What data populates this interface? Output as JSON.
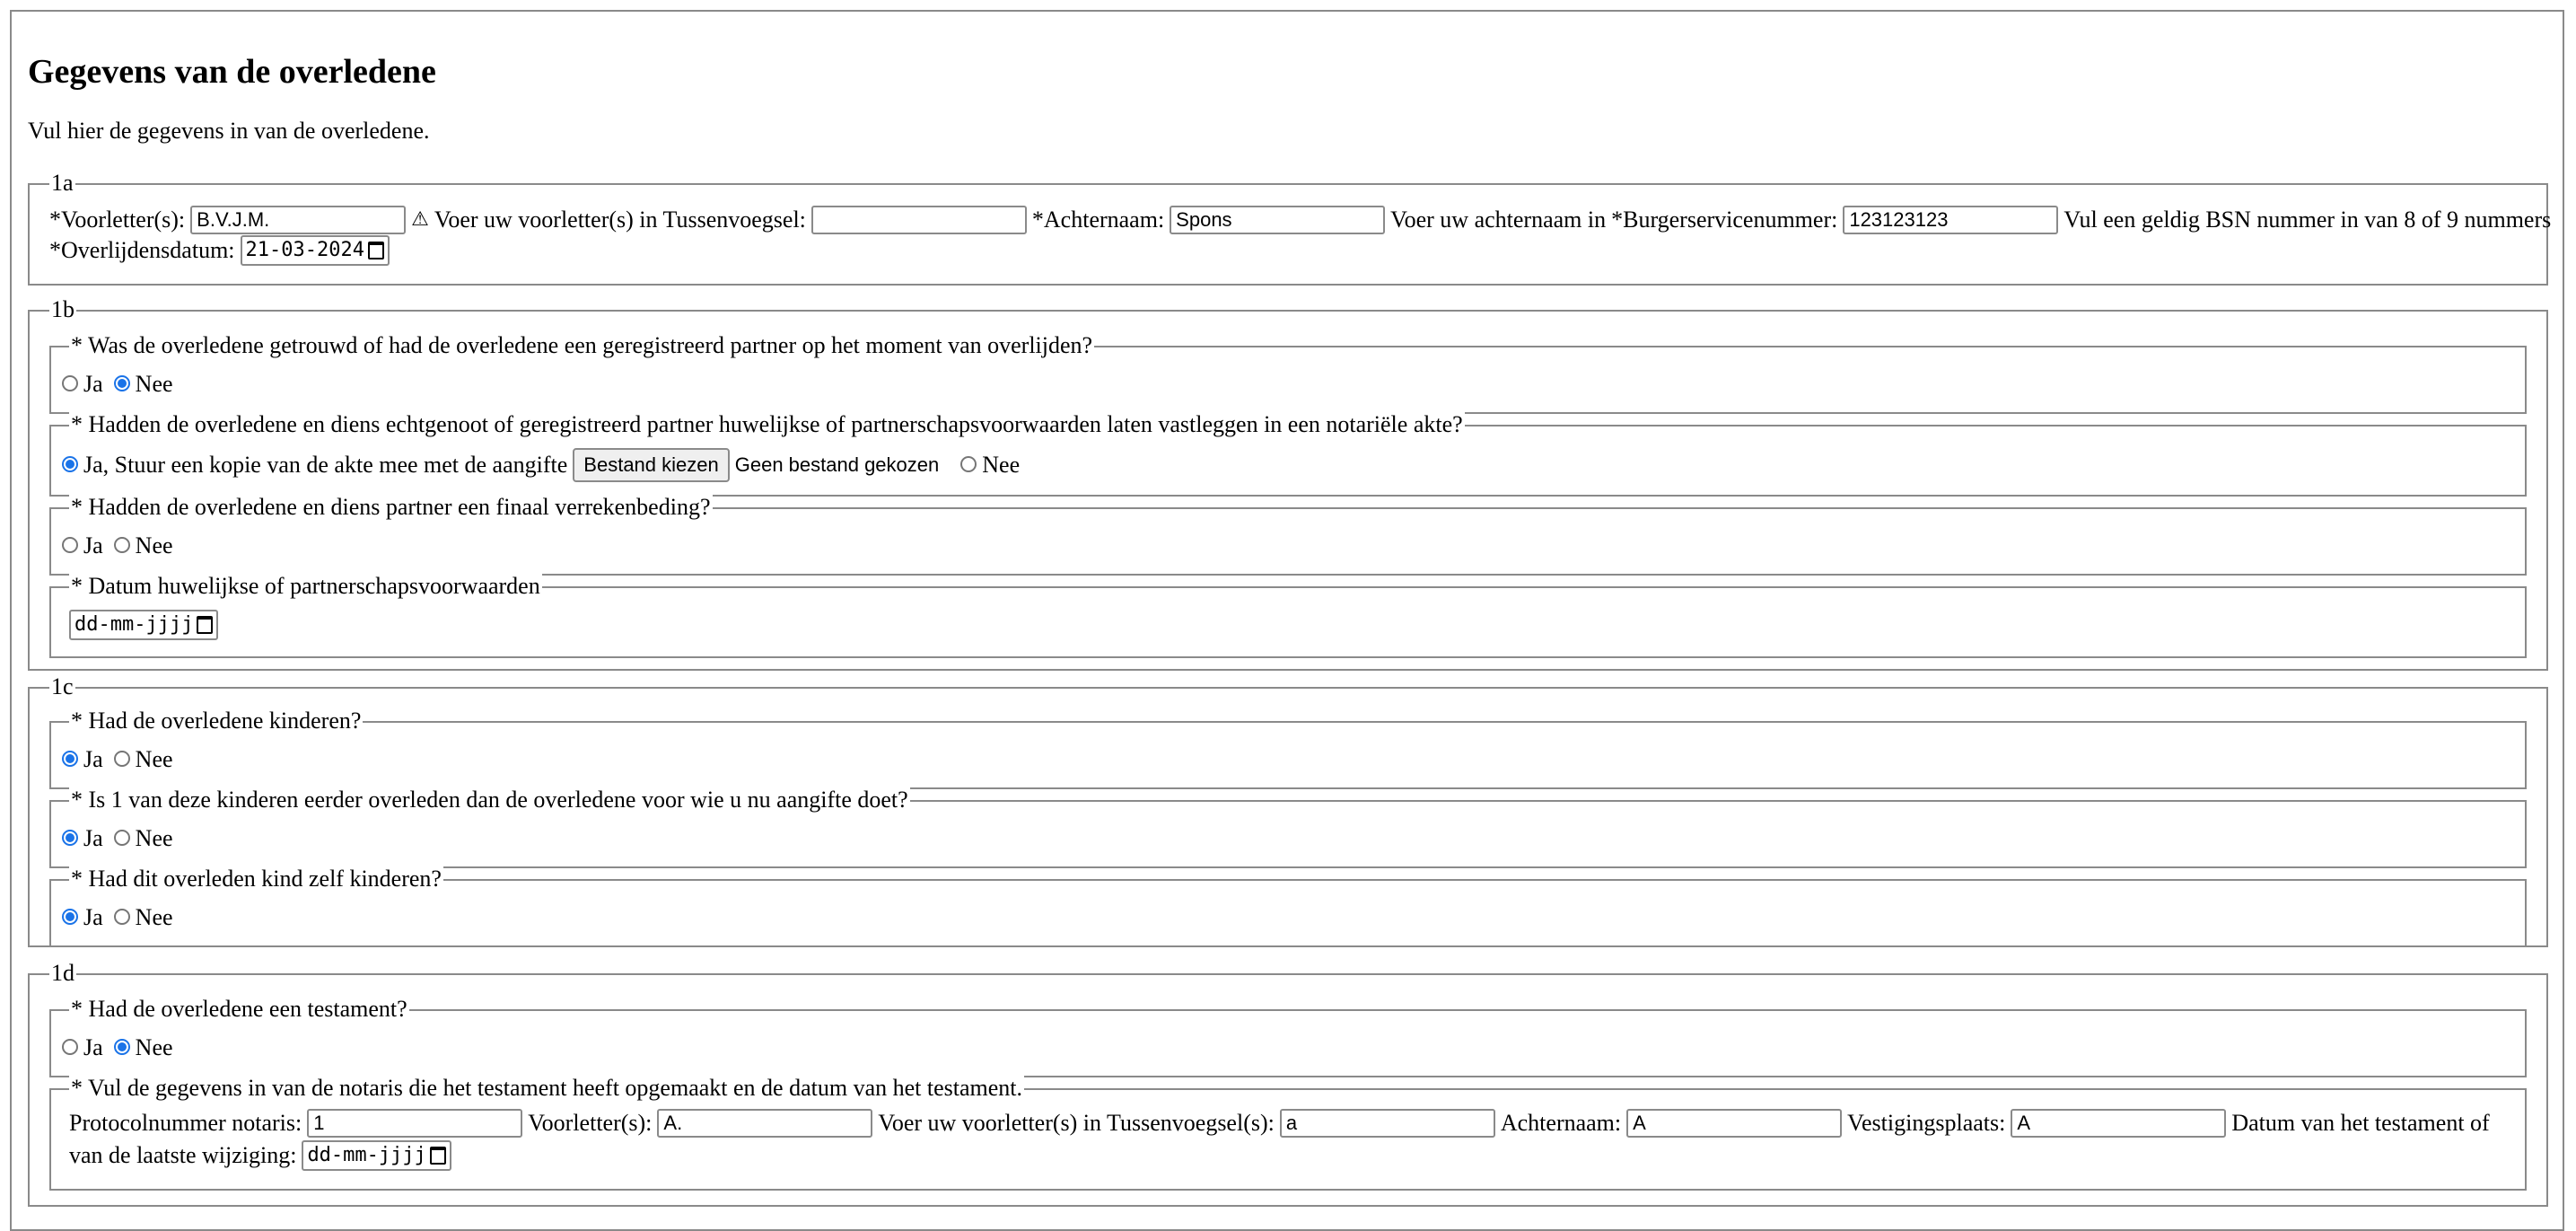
{
  "page": {
    "title": "Gegevens van de overledene",
    "intro": "Vul hier de gegevens in van de overledene."
  },
  "s1a": {
    "legend": "1a",
    "voorletters_label": "*Voorletter(s):",
    "voorletters_value": "B.V.J.M.",
    "voorletters_hint": "Voer uw voorletter(s) in",
    "tussenvoegsel_label": "Tussenvoegsel:",
    "tussenvoegsel_value": "",
    "achternaam_label": "*Achternaam:",
    "achternaam_value": "Spons",
    "achternaam_hint": "Voer uw achternaam in",
    "bsn_label": "*Burgerservicenummer:",
    "bsn_value": "123123123",
    "bsn_hint": "Vul een geldig BSN nummer in van 8 of 9 nummers",
    "overlijdensdatum_label": "*Overlijdensdatum:",
    "overlijdensdatum_value": "21-03-2024",
    "warning_icon": "warning-triangle-icon"
  },
  "s1b": {
    "legend": "1b",
    "q1": {
      "legend": "* Was de overledene getrouwd of had de overledene een geregistreerd partner op het moment van overlijden?",
      "opt_ja": "Ja",
      "opt_nee": "Nee",
      "selected": "Nee"
    },
    "q2": {
      "legend": "* Hadden de overledene en diens echtgenoot of geregistreerd partner huwelijkse of partnerschapsvoorwaarden laten vastleggen in een notariële akte?",
      "opt_ja": "Ja, Stuur een kopie van de akte mee met de aangifte",
      "file_button": "Bestand kiezen",
      "file_status": "Geen bestand gekozen",
      "opt_nee": "Nee",
      "selected": "Ja"
    },
    "q3": {
      "legend": "* Hadden de overledene en diens partner een finaal verrekenbeding?",
      "opt_ja": "Ja",
      "opt_nee": "Nee",
      "selected": ""
    },
    "q4": {
      "legend": "* Datum huwelijkse of partnerschapsvoorwaarden",
      "date_placeholder": "dd-mm-jjjj"
    }
  },
  "s1c": {
    "legend": "1c",
    "q1": {
      "legend": "* Had de overledene kinderen?",
      "opt_ja": "Ja",
      "opt_nee": "Nee",
      "selected": "Ja"
    },
    "q2": {
      "legend": "* Is 1 van deze kinderen eerder overleden dan de overledene voor wie u nu aangifte doet?",
      "opt_ja": "Ja",
      "opt_nee": "Nee",
      "selected": "Ja"
    },
    "q3": {
      "legend": "* Had dit overleden kind zelf kinderen?",
      "opt_ja": "Ja",
      "opt_nee": "Nee",
      "selected": "Ja"
    }
  },
  "s1d": {
    "legend": "1d",
    "q1": {
      "legend": "* Had de overledene een testament?",
      "opt_ja": "Ja",
      "opt_nee": "Nee",
      "selected": "Nee"
    },
    "q2": {
      "legend": "* Vul de gegevens in van de notaris die het testament heeft opgemaakt en de datum van het testament.",
      "protocol_label": "Protocolnummer notaris:",
      "protocol_value": "1",
      "voorletters_label": "Voorletter(s):",
      "voorletters_value": "A.",
      "voorletters_hint": "Voer uw voorletter(s) in",
      "tussenvoegsel_label": "Tussenvoegsel(s):",
      "tussenvoegsel_value": "a",
      "achternaam_label": "Achternaam:",
      "achternaam_value": "A",
      "vestiging_label": "Vestigingsplaats:",
      "vestiging_value": "A",
      "datum_label_1": "Datum van het testament of",
      "datum_label_2": "van de laatste wijziging:",
      "date_placeholder": "dd-mm-jjjj"
    }
  }
}
